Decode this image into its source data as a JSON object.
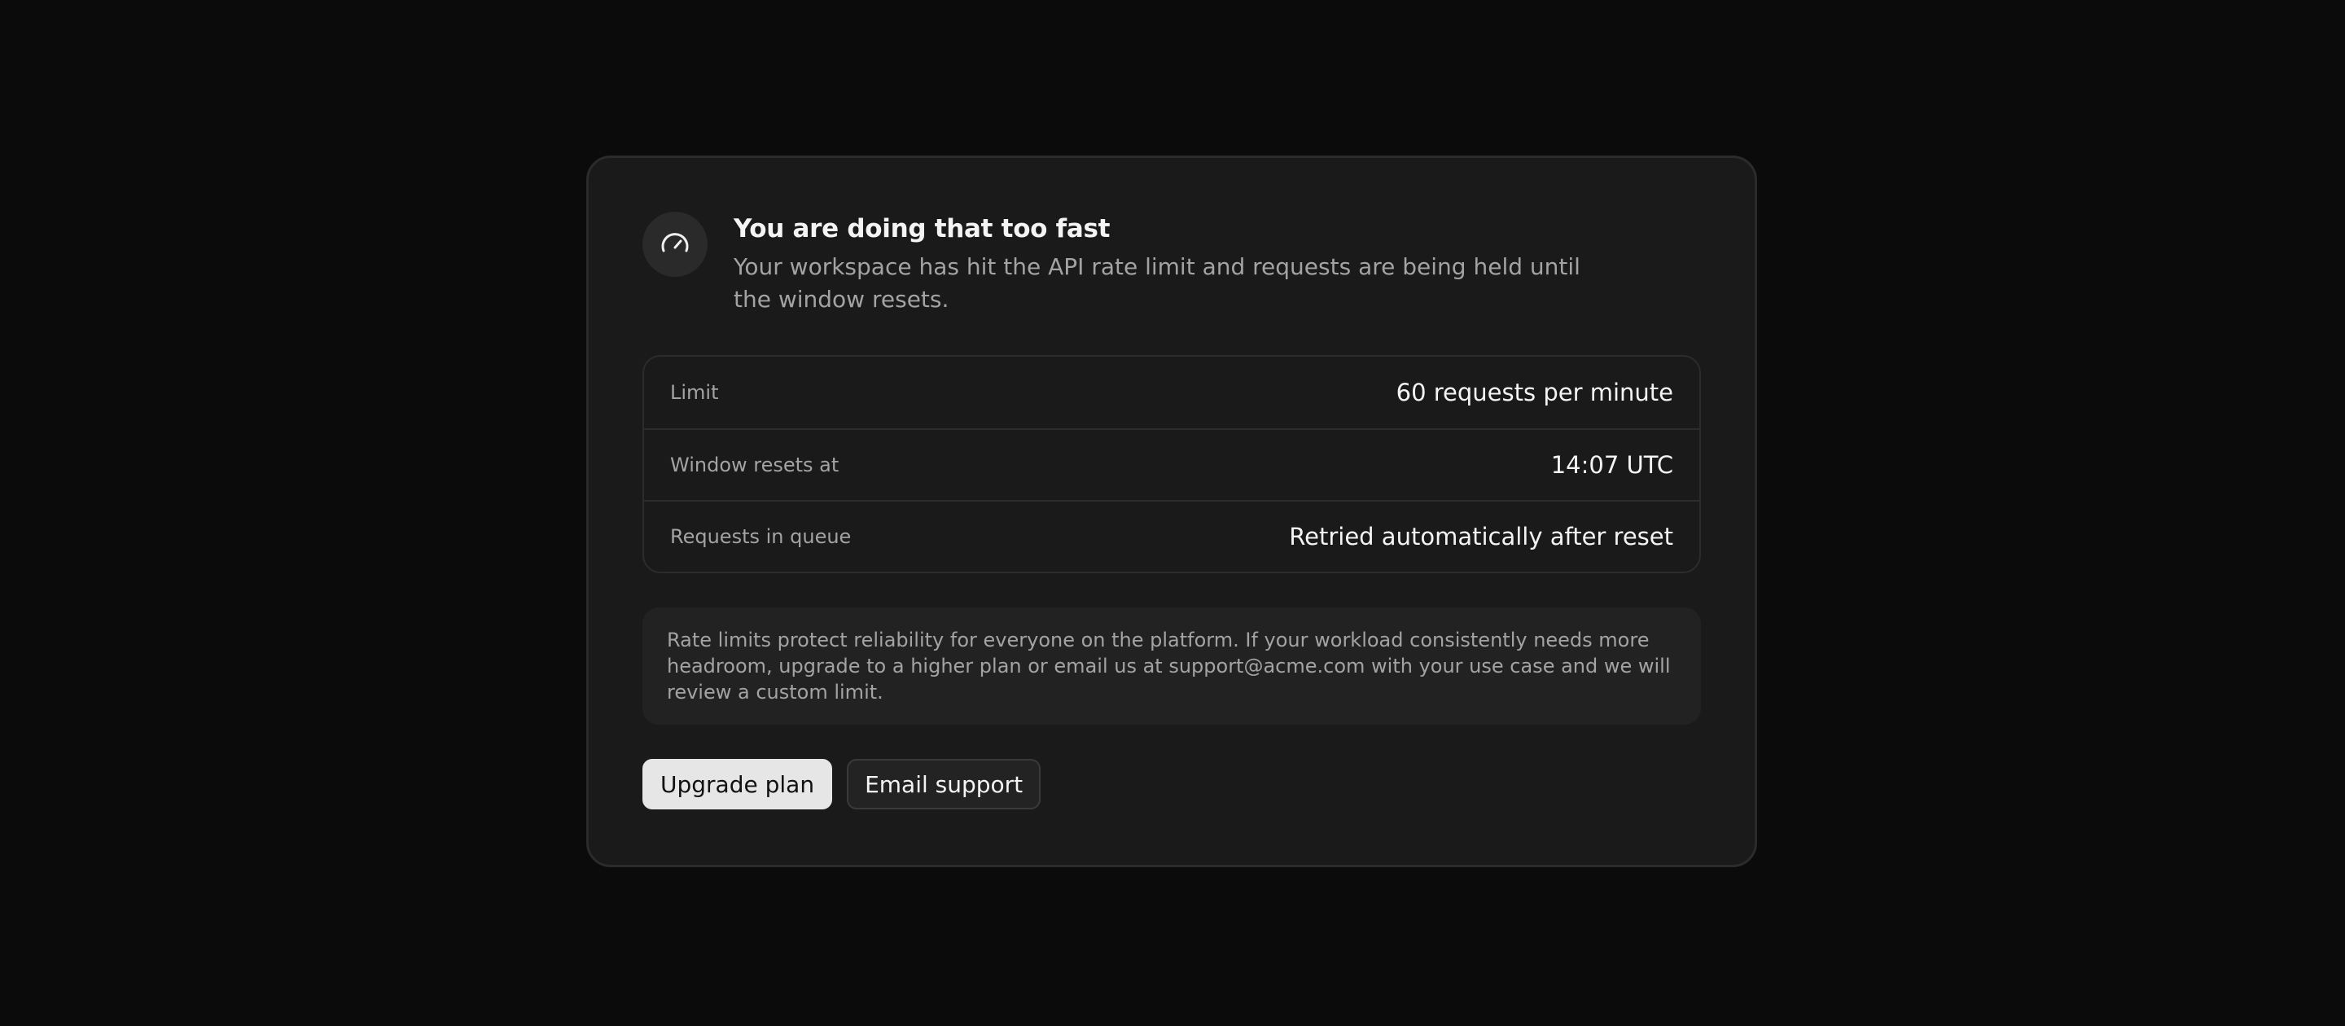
{
  "dialog": {
    "icon": "gauge-icon",
    "title": "You are doing that too fast",
    "description": "Your workspace has hit the API rate limit and requests are being held until the window resets.",
    "details": [
      {
        "label": "Limit",
        "value": "60 requests per minute"
      },
      {
        "label": "Window resets at",
        "value": "14:07 UTC"
      },
      {
        "label": "Requests in queue",
        "value": "Retried automatically after reset"
      }
    ],
    "notice": "Rate limits protect reliability for everyone on the platform. If your workload consistently needs more headroom, upgrade to a higher plan or email us at support@acme.com with your use case and we will review a custom limit.",
    "actions": {
      "primary_label": "Upgrade plan",
      "secondary_label": "Email support"
    }
  },
  "colors": {
    "background": "#0b0b0b",
    "card": "#1a1a1a",
    "primary_button": "#e6e6e6",
    "text_primary": "#f4f4f4",
    "text_muted": "#a3a3a3"
  }
}
